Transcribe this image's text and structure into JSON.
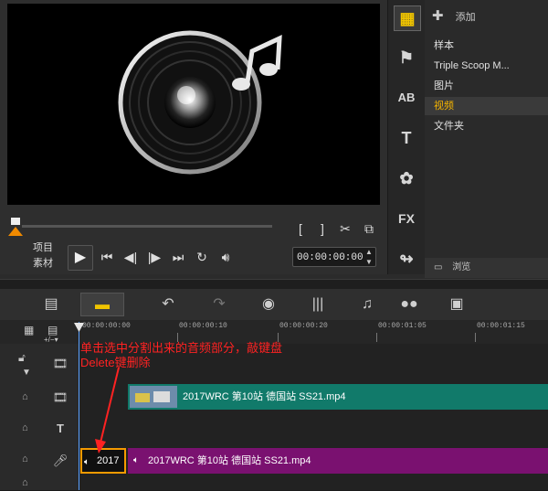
{
  "preview": {
    "mode_project": "项目",
    "mode_clip": "素材",
    "timecode": "00:00:00:00",
    "mark_in": "[",
    "mark_out": "]"
  },
  "library": {
    "add_label": "添加",
    "items": [
      "样本",
      "Triple Scoop M...",
      "图片",
      "视频",
      "文件夹"
    ],
    "selected_index": 3,
    "browse_label": "浏览"
  },
  "sidebar_icons": [
    "media-icon",
    "instant-project-icon",
    "transition-icon",
    "title-icon",
    "graphic-icon",
    "filter-icon",
    "path-icon"
  ],
  "timeline": {
    "ruler_labels": [
      "00:00:00:00",
      "00:00:00:10",
      "00:00:00:20",
      "00:00:01:05",
      "00:00:01:15"
    ],
    "video_clip_label": "2017WRC 第10站 德国站 SS21.mp4",
    "audio_clip_label": "2017WRC 第10站 德国站 SS21.mp4",
    "audio_split_label": "2017",
    "annotation": "单击选中分割出来的音频部分，敲键盘Delete键删除"
  },
  "colors": {
    "accent": "#f0c400",
    "video_clip": "#117a6a",
    "audio_clip": "#7a1170",
    "annotation": "#ff2222",
    "selection_border": "#f59a00"
  }
}
